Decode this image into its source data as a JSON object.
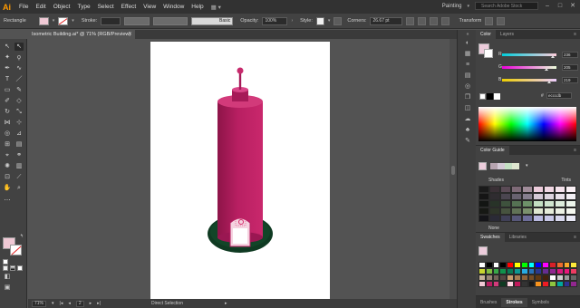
{
  "menubar": {
    "app_logo": "Ai",
    "items": [
      "File",
      "Edit",
      "Object",
      "Type",
      "Select",
      "Effect",
      "View",
      "Window",
      "Help"
    ],
    "workspace": "Painting",
    "search_placeholder": "Search Adobe Stock"
  },
  "controlbar": {
    "selection_type": "Rectangle",
    "stroke_label": "Stroke:",
    "brush_label": "Basic",
    "opacity_label": "Opacity:",
    "opacity_value": "100%",
    "style_label": "Style:",
    "corners_label": "Corners:",
    "corners_value": "26.67 pt",
    "transform_label": "Transform",
    "fill_color": "#f0c9d5"
  },
  "document": {
    "tab_title": "Isometric Building.ai* @ 71% (RGB/Preview)"
  },
  "statusbar": {
    "zoom": "71%",
    "artboard_num": "2",
    "tool_name": "Direct Selection"
  },
  "color_panel": {
    "tabs": [
      "Color",
      "Layers"
    ],
    "r_label": "R",
    "r_value": "236",
    "g_label": "G",
    "g_value": "205",
    "b_label": "B",
    "b_value": "219",
    "hex_prefix": "#",
    "hex_value": "ecccdb"
  },
  "color_guide": {
    "title": "Color Guide",
    "shades_label": "Shades",
    "tints_label": "Tints",
    "none_label": "None"
  },
  "swatches": {
    "tabs": [
      "Swatches",
      "Libraries"
    ]
  },
  "bottom_tabs": [
    "Brushes",
    "Strokes",
    "Symbols"
  ],
  "colors": {
    "tower_body": "#b81f62",
    "tower_top": "#d23a7a",
    "base_ellipse": "#0f3a22",
    "door": "#f5d3e0"
  }
}
